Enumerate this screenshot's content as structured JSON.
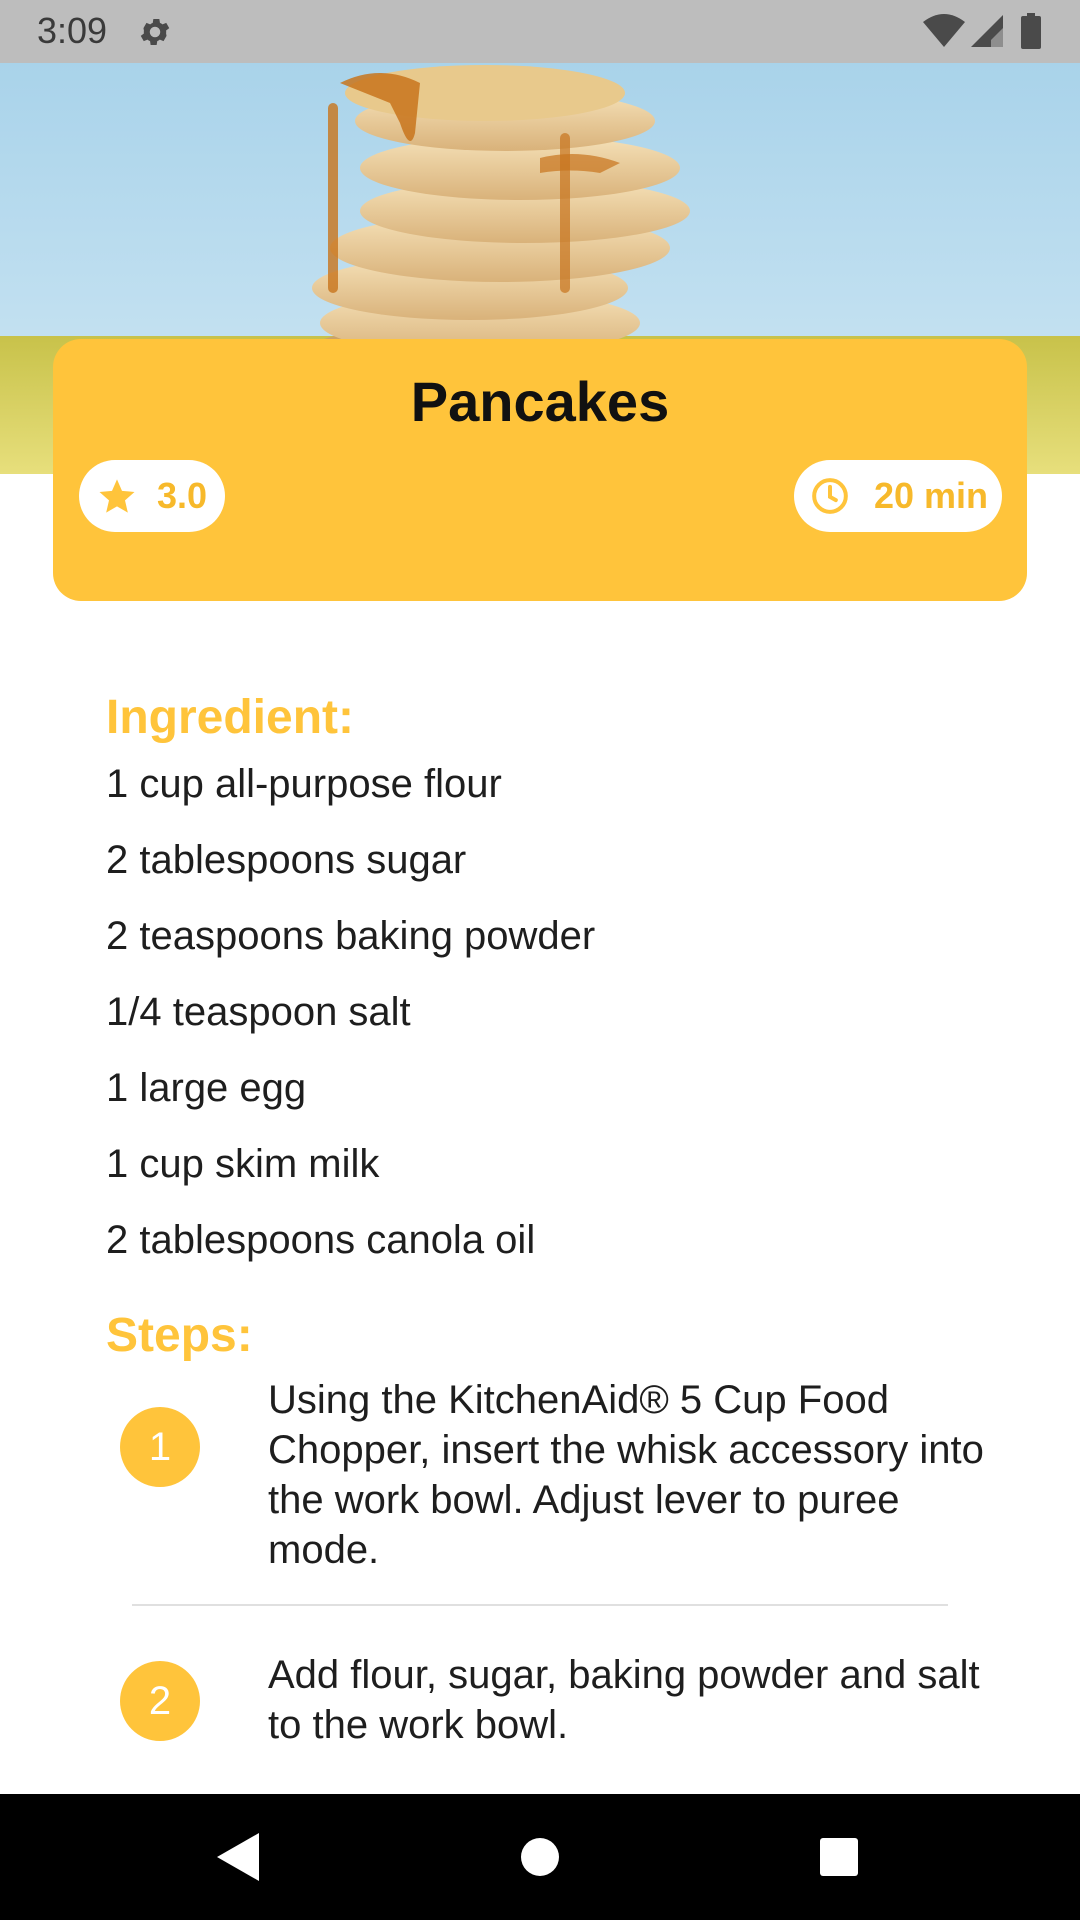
{
  "status_bar": {
    "time": "3:09",
    "icons": [
      "gear-icon",
      "wifi-icon",
      "signal-icon",
      "battery-icon"
    ]
  },
  "recipe": {
    "title": "Pancakes",
    "rating": "3.0",
    "time": "20 min"
  },
  "ingredients": {
    "heading": "Ingredient:",
    "items": [
      "1 cup all-purpose flour",
      "2 tablespoons sugar",
      "2 teaspoons baking powder",
      "1/4 teaspoon salt",
      "1 large egg",
      "1 cup skim milk",
      "2 tablespoons canola oil"
    ]
  },
  "steps": {
    "heading": "Steps:",
    "items": [
      {
        "number": "1",
        "text": "Using the KitchenAid® 5 Cup Food Chopper, insert the whisk accessory into the work bowl. Adjust lever to puree mode."
      },
      {
        "number": "2",
        "text": "Add flour, sugar, baking powder and salt to the work bowl."
      }
    ]
  },
  "theme": {
    "accent": "#ffc43b",
    "text": "#1e1e1e",
    "status_bar_bg": "#bdbdbd",
    "nav_bar_bg": "#000000"
  },
  "nav_bar": {
    "icons": [
      "back-icon",
      "home-icon",
      "recents-icon"
    ]
  }
}
